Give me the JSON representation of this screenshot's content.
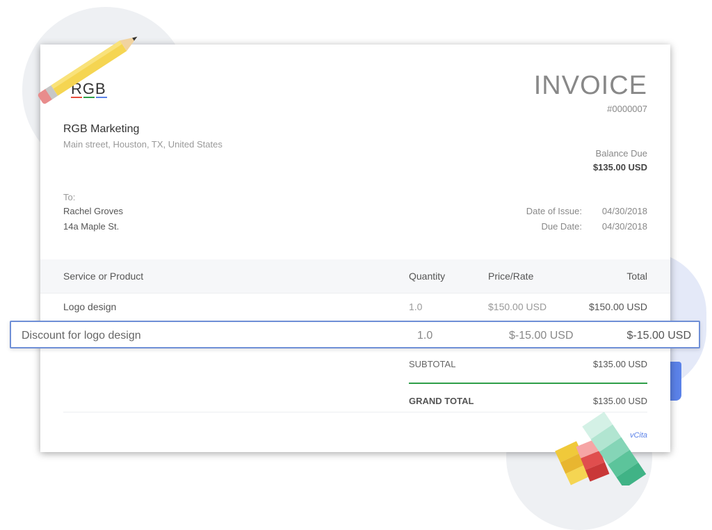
{
  "company": {
    "logo_text": "RGB",
    "name": "RGB Marketing",
    "address": "Main street, Houston, TX, United States"
  },
  "invoice": {
    "title": "INVOICE",
    "number": "#0000007",
    "balance_label": "Balance Due",
    "balance_amount": "$135.00 USD"
  },
  "recipient": {
    "to_label": "To:",
    "name": "Rachel Groves",
    "address": "14a Maple St."
  },
  "dates": {
    "issue_label": "Date of Issue:",
    "issue_value": "04/30/2018",
    "due_label": "Due Date:",
    "due_value": "04/30/2018"
  },
  "table": {
    "headers": [
      "Service or Product",
      "Quantity",
      "Price/Rate",
      "Total"
    ],
    "rows": [
      {
        "service": "Logo design",
        "quantity": "1.0",
        "price": "$150.00 USD",
        "total": "$150.00 USD"
      },
      {
        "service": "Discount for logo design",
        "quantity": "1.0",
        "price": "$-15.00 USD",
        "total": "$-15.00 USD"
      }
    ]
  },
  "summary": {
    "subtotal_label": "SUBTOTAL",
    "subtotal_value": "$135.00 USD",
    "grand_total_label": "GRAND TOTAL",
    "grand_total_value": "$135.00 USD"
  },
  "footer": {
    "brand": "vCita"
  },
  "colors": {
    "logo_red": "#e74c3c",
    "logo_green": "#2e9e48",
    "logo_blue": "#5b82e8",
    "highlight_border": "#6f8fd6",
    "total_line": "#2e9e48"
  }
}
